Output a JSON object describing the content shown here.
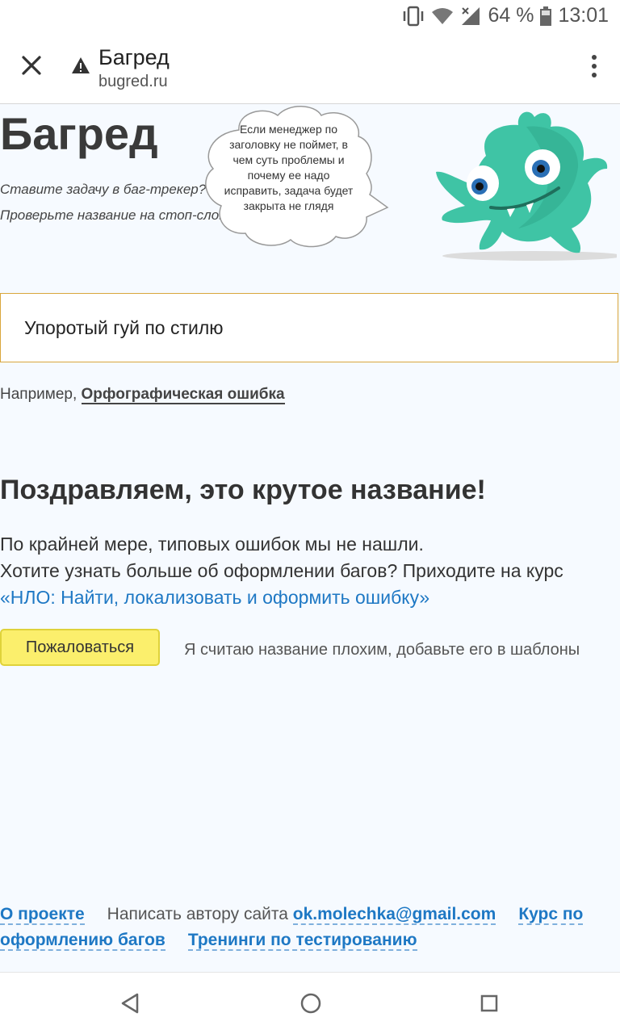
{
  "status_bar": {
    "battery": "64 %",
    "time": "13:01"
  },
  "browser": {
    "title": "Багред",
    "url": "bugred.ru"
  },
  "site": {
    "title": "Багред",
    "tagline_1": "Ставите задачу в баг-трекер?",
    "tagline_2": "Проверьте название на стоп-слова",
    "bubble": "Если менеджер по заголовку не поймет, в чем суть проблемы и почему ее надо исправить, задача будет закрыта не глядя"
  },
  "title_input": {
    "value": "Упоротый гуй по стилю"
  },
  "example": {
    "prefix": "Например, ",
    "link": "Орфографическая ошибка"
  },
  "result": {
    "heading": "Поздравляем, это крутое название!",
    "line_1": "По крайней мере, типовых ошибок мы не нашли.",
    "line_2": "Хотите узнать больше об оформлении багов? Приходите на курс ",
    "course_link": "«НЛО: Найти, локализовать и оформить ошибку»"
  },
  "complain": {
    "button": "Пожаловаться",
    "text": "Я считаю название плохим, добавьте его в шаблоны"
  },
  "footer": {
    "about": "О проекте",
    "write_author": "Написать автору сайта ",
    "email": "ok.molechka@gmail.com",
    "course": "Курс по оформлению багов",
    "trainings": "Тренинги по тестированию"
  },
  "colors": {
    "accent_link": "#1e78c4",
    "button_yellow": "#fbef6c",
    "input_border": "#d9a63c",
    "monster": "#3fc4a5"
  }
}
